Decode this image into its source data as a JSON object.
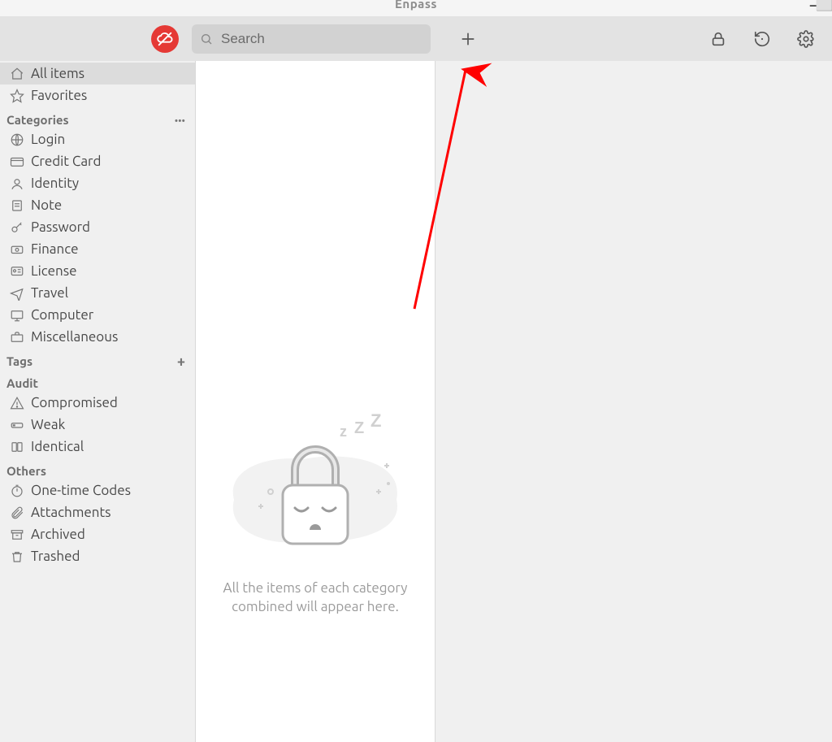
{
  "window": {
    "title": "Enpass"
  },
  "toolbar": {
    "search_placeholder": "Search"
  },
  "sidebar": {
    "top": [
      {
        "label": "All items",
        "selected": true
      },
      {
        "label": "Favorites"
      }
    ],
    "sections": {
      "categories": {
        "header": "Categories",
        "items": [
          {
            "label": "Login"
          },
          {
            "label": "Credit Card"
          },
          {
            "label": "Identity"
          },
          {
            "label": "Note"
          },
          {
            "label": "Password"
          },
          {
            "label": "Finance"
          },
          {
            "label": "License"
          },
          {
            "label": "Travel"
          },
          {
            "label": "Computer"
          },
          {
            "label": "Miscellaneous"
          }
        ]
      },
      "tags": {
        "header": "Tags"
      },
      "audit": {
        "header": "Audit",
        "items": [
          {
            "label": "Compromised"
          },
          {
            "label": "Weak"
          },
          {
            "label": "Identical"
          }
        ]
      },
      "others": {
        "header": "Others",
        "items": [
          {
            "label": "One-time Codes"
          },
          {
            "label": "Attachments"
          },
          {
            "label": "Archived"
          },
          {
            "label": "Trashed"
          }
        ]
      }
    }
  },
  "listpane": {
    "empty_message_line1": "All the items of each category",
    "empty_message_line2": "combined will appear here."
  }
}
